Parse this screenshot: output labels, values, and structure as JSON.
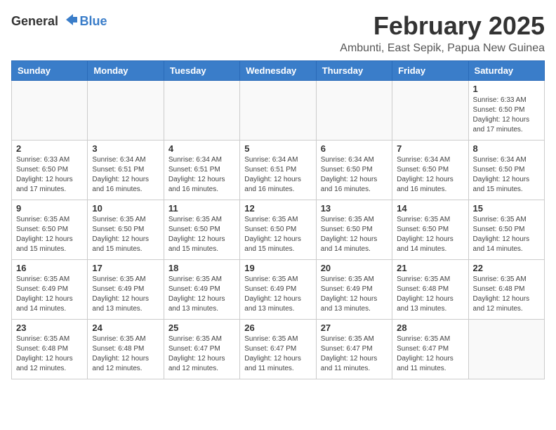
{
  "header": {
    "logo_general": "General",
    "logo_blue": "Blue",
    "title": "February 2025",
    "subtitle": "Ambunti, East Sepik, Papua New Guinea"
  },
  "calendar": {
    "days_of_week": [
      "Sunday",
      "Monday",
      "Tuesday",
      "Wednesday",
      "Thursday",
      "Friday",
      "Saturday"
    ],
    "weeks": [
      [
        {
          "day": "",
          "info": ""
        },
        {
          "day": "",
          "info": ""
        },
        {
          "day": "",
          "info": ""
        },
        {
          "day": "",
          "info": ""
        },
        {
          "day": "",
          "info": ""
        },
        {
          "day": "",
          "info": ""
        },
        {
          "day": "1",
          "info": "Sunrise: 6:33 AM\nSunset: 6:50 PM\nDaylight: 12 hours\nand 17 minutes."
        }
      ],
      [
        {
          "day": "2",
          "info": "Sunrise: 6:33 AM\nSunset: 6:50 PM\nDaylight: 12 hours\nand 17 minutes."
        },
        {
          "day": "3",
          "info": "Sunrise: 6:34 AM\nSunset: 6:51 PM\nDaylight: 12 hours\nand 16 minutes."
        },
        {
          "day": "4",
          "info": "Sunrise: 6:34 AM\nSunset: 6:51 PM\nDaylight: 12 hours\nand 16 minutes."
        },
        {
          "day": "5",
          "info": "Sunrise: 6:34 AM\nSunset: 6:51 PM\nDaylight: 12 hours\nand 16 minutes."
        },
        {
          "day": "6",
          "info": "Sunrise: 6:34 AM\nSunset: 6:50 PM\nDaylight: 12 hours\nand 16 minutes."
        },
        {
          "day": "7",
          "info": "Sunrise: 6:34 AM\nSunset: 6:50 PM\nDaylight: 12 hours\nand 16 minutes."
        },
        {
          "day": "8",
          "info": "Sunrise: 6:34 AM\nSunset: 6:50 PM\nDaylight: 12 hours\nand 15 minutes."
        }
      ],
      [
        {
          "day": "9",
          "info": "Sunrise: 6:35 AM\nSunset: 6:50 PM\nDaylight: 12 hours\nand 15 minutes."
        },
        {
          "day": "10",
          "info": "Sunrise: 6:35 AM\nSunset: 6:50 PM\nDaylight: 12 hours\nand 15 minutes."
        },
        {
          "day": "11",
          "info": "Sunrise: 6:35 AM\nSunset: 6:50 PM\nDaylight: 12 hours\nand 15 minutes."
        },
        {
          "day": "12",
          "info": "Sunrise: 6:35 AM\nSunset: 6:50 PM\nDaylight: 12 hours\nand 15 minutes."
        },
        {
          "day": "13",
          "info": "Sunrise: 6:35 AM\nSunset: 6:50 PM\nDaylight: 12 hours\nand 14 minutes."
        },
        {
          "day": "14",
          "info": "Sunrise: 6:35 AM\nSunset: 6:50 PM\nDaylight: 12 hours\nand 14 minutes."
        },
        {
          "day": "15",
          "info": "Sunrise: 6:35 AM\nSunset: 6:50 PM\nDaylight: 12 hours\nand 14 minutes."
        }
      ],
      [
        {
          "day": "16",
          "info": "Sunrise: 6:35 AM\nSunset: 6:49 PM\nDaylight: 12 hours\nand 14 minutes."
        },
        {
          "day": "17",
          "info": "Sunrise: 6:35 AM\nSunset: 6:49 PM\nDaylight: 12 hours\nand 13 minutes."
        },
        {
          "day": "18",
          "info": "Sunrise: 6:35 AM\nSunset: 6:49 PM\nDaylight: 12 hours\nand 13 minutes."
        },
        {
          "day": "19",
          "info": "Sunrise: 6:35 AM\nSunset: 6:49 PM\nDaylight: 12 hours\nand 13 minutes."
        },
        {
          "day": "20",
          "info": "Sunrise: 6:35 AM\nSunset: 6:49 PM\nDaylight: 12 hours\nand 13 minutes."
        },
        {
          "day": "21",
          "info": "Sunrise: 6:35 AM\nSunset: 6:48 PM\nDaylight: 12 hours\nand 13 minutes."
        },
        {
          "day": "22",
          "info": "Sunrise: 6:35 AM\nSunset: 6:48 PM\nDaylight: 12 hours\nand 12 minutes."
        }
      ],
      [
        {
          "day": "23",
          "info": "Sunrise: 6:35 AM\nSunset: 6:48 PM\nDaylight: 12 hours\nand 12 minutes."
        },
        {
          "day": "24",
          "info": "Sunrise: 6:35 AM\nSunset: 6:48 PM\nDaylight: 12 hours\nand 12 minutes."
        },
        {
          "day": "25",
          "info": "Sunrise: 6:35 AM\nSunset: 6:47 PM\nDaylight: 12 hours\nand 12 minutes."
        },
        {
          "day": "26",
          "info": "Sunrise: 6:35 AM\nSunset: 6:47 PM\nDaylight: 12 hours\nand 11 minutes."
        },
        {
          "day": "27",
          "info": "Sunrise: 6:35 AM\nSunset: 6:47 PM\nDaylight: 12 hours\nand 11 minutes."
        },
        {
          "day": "28",
          "info": "Sunrise: 6:35 AM\nSunset: 6:47 PM\nDaylight: 12 hours\nand 11 minutes."
        },
        {
          "day": "",
          "info": ""
        }
      ]
    ]
  }
}
